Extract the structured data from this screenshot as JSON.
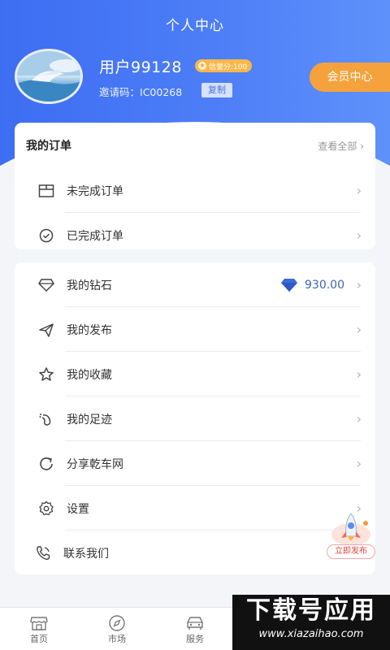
{
  "header": {
    "title": "个人中心"
  },
  "profile": {
    "username": "用户99128",
    "credit": "信誉分:100",
    "invite_label": "邀请码：",
    "invite_code": "IC00268",
    "copy": "复制",
    "vip": "会员中心"
  },
  "orders": {
    "title": "我的订单",
    "view_all": "查看全部",
    "items": [
      {
        "label": "未完成订单",
        "icon": "box-icon"
      },
      {
        "label": "已完成订单",
        "icon": "check-circle-icon"
      }
    ]
  },
  "menu": {
    "items": [
      {
        "label": "我的钻石",
        "icon": "diamond-icon",
        "value": "930.00"
      },
      {
        "label": "我的发布",
        "icon": "send-icon"
      },
      {
        "label": "我的收藏",
        "icon": "star-icon"
      },
      {
        "label": "我的足迹",
        "icon": "footprint-icon"
      },
      {
        "label": "分享乾车网",
        "icon": "share-icon"
      },
      {
        "label": "设置",
        "icon": "gear-icon"
      },
      {
        "label": "联系我们",
        "icon": "phone-icon"
      }
    ]
  },
  "fab": {
    "label": "立即发布"
  },
  "tabs": [
    {
      "label": "首页",
      "icon": "home-icon"
    },
    {
      "label": "市场",
      "icon": "compass-icon"
    },
    {
      "label": "服务",
      "icon": "car-icon"
    }
  ],
  "watermark": {
    "big": "下载号应用",
    "small": "www.xiazaihao.com"
  },
  "colors": {
    "primary": "#3d6df2",
    "accent": "#f6a23c",
    "diamond": "#3e64b8"
  }
}
